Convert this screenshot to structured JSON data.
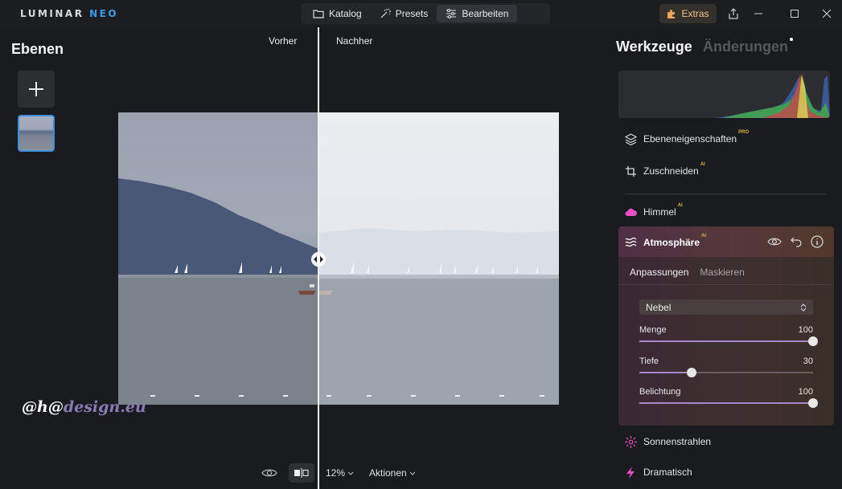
{
  "app": {
    "logo_main": "LUMINAR",
    "logo_accent": "NEO"
  },
  "main_tabs": [
    {
      "label": "Katalog",
      "icon": "folder-icon"
    },
    {
      "label": "Presets",
      "icon": "sparkle-icon"
    },
    {
      "label": "Bearbeiten",
      "icon": "sliders-icon"
    }
  ],
  "extras": {
    "label": "Extras",
    "icon": "puzzle-icon"
  },
  "left_panel": {
    "title": "Ebenen"
  },
  "canvas": {
    "before_label": "Vorher",
    "after_label": "Nachher",
    "watermark_prefix": "@h@",
    "watermark_suffix": "design.eu"
  },
  "bottom_bar": {
    "zoom": "12%",
    "actions": "Aktionen"
  },
  "right_panel": {
    "tools_title": "Werkzeuge",
    "changes_title": "Änderungen",
    "tools": [
      {
        "label": "Ebeneneigenschaften",
        "badge": "PRO",
        "icon": "layers-icon"
      },
      {
        "label": "Zuschneiden",
        "badge": "AI",
        "icon": "crop-icon"
      },
      {
        "label": "Himmel",
        "badge": "AI",
        "icon": "cloud-icon"
      },
      {
        "label": "Sonnenstrahlen",
        "badge": "",
        "icon": "sunrays-icon"
      },
      {
        "label": "Dramatisch",
        "badge": "",
        "icon": "lightning-icon"
      }
    ],
    "atmosphere": {
      "title": "Atmosphäre",
      "badge": "AI",
      "tabs": [
        "Anpassungen",
        "Maskieren"
      ],
      "mode": "Nebel",
      "sliders": [
        {
          "label": "Menge",
          "value": 100,
          "display": "100",
          "min": 0,
          "max": 100
        },
        {
          "label": "Tiefe",
          "value": 30,
          "display": "30",
          "min": 0,
          "max": 100
        },
        {
          "label": "Belichtung",
          "value": 100,
          "display": "100",
          "min": 0,
          "max": 100
        }
      ]
    }
  },
  "colors": {
    "accent": "#3d8ee0",
    "ai_badge": "#e0b23b",
    "sky_icon": "#e64fc5",
    "extras": "#f1c08a"
  }
}
